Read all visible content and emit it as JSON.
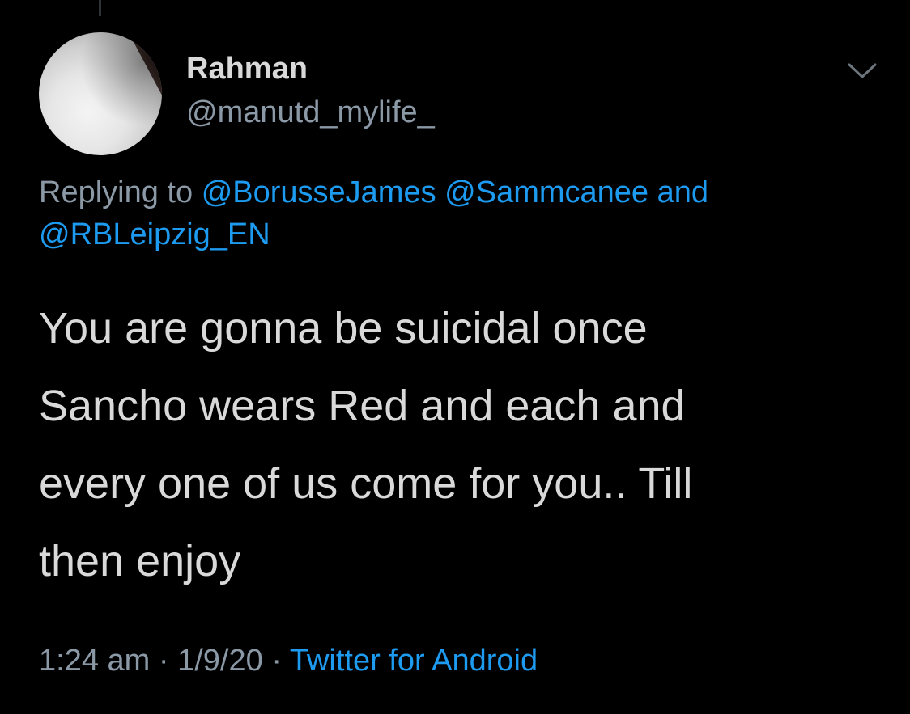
{
  "user": {
    "display_name": "Rahman",
    "handle": "@manutd_mylife_"
  },
  "reply": {
    "prefix": "Replying to",
    "mentions": [
      "@BorusseJames",
      "@Sammcanee"
    ],
    "conjunction": "and",
    "last_mention": "@RBLeipzig_EN"
  },
  "tweet": {
    "lines": [
      "You are gonna be suicidal once",
      "Sancho wears Red and each and",
      "every one of us come for you.. Till",
      "then enjoy"
    ]
  },
  "meta": {
    "time": "1:24 am",
    "date": "1/9/20",
    "separator": "·",
    "source": "Twitter for Android"
  },
  "icons": {
    "more": "chevron-down-icon"
  },
  "colors": {
    "background": "#000000",
    "text": "#d9d9d9",
    "secondary": "#8b98a5",
    "link": "#1d9bf0"
  }
}
